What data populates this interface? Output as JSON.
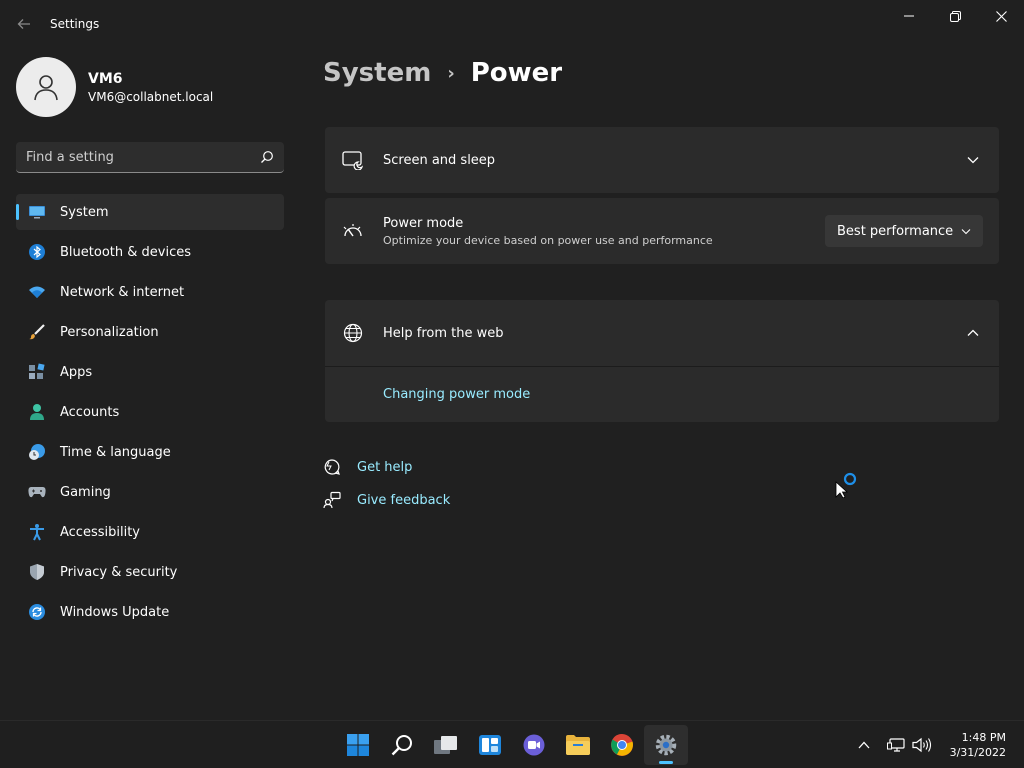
{
  "window": {
    "title": "Settings"
  },
  "profile": {
    "name": "VM6",
    "email": "VM6@collabnet.local"
  },
  "search": {
    "placeholder": "Find a setting"
  },
  "sidebar": {
    "items": [
      {
        "label": "System",
        "icon": "monitor-icon",
        "selected": true
      },
      {
        "label": "Bluetooth & devices",
        "icon": "bluetooth-icon"
      },
      {
        "label": "Network & internet",
        "icon": "wifi-icon"
      },
      {
        "label": "Personalization",
        "icon": "brush-icon"
      },
      {
        "label": "Apps",
        "icon": "apps-icon"
      },
      {
        "label": "Accounts",
        "icon": "person-icon"
      },
      {
        "label": "Time & language",
        "icon": "clock-globe-icon"
      },
      {
        "label": "Gaming",
        "icon": "gamepad-icon"
      },
      {
        "label": "Accessibility",
        "icon": "accessibility-icon"
      },
      {
        "label": "Privacy & security",
        "icon": "shield-icon"
      },
      {
        "label": "Windows Update",
        "icon": "update-icon"
      }
    ]
  },
  "breadcrumb": {
    "parent": "System",
    "separator": "›",
    "current": "Power"
  },
  "cards": {
    "screen_sleep": {
      "title": "Screen and sleep"
    },
    "power_mode": {
      "title": "Power mode",
      "subtitle": "Optimize your device based on power use and performance",
      "selected_value": "Best performance"
    },
    "help_web": {
      "title": "Help from the web",
      "link": "Changing power mode"
    }
  },
  "footer_links": {
    "get_help": "Get help",
    "give_feedback": "Give feedback"
  },
  "taskbar": {
    "apps": [
      "start-icon",
      "search-icon",
      "task-view-icon",
      "widgets-icon",
      "teams-chat-icon",
      "file-explorer-icon",
      "chrome-icon",
      "settings-icon"
    ],
    "active_app": "settings-icon",
    "time": "1:48 PM",
    "date": "3/31/2022"
  },
  "colors": {
    "background": "#202020",
    "card": "#2b2b2b",
    "accent": "#4cc2ff",
    "link": "#99ebff"
  }
}
